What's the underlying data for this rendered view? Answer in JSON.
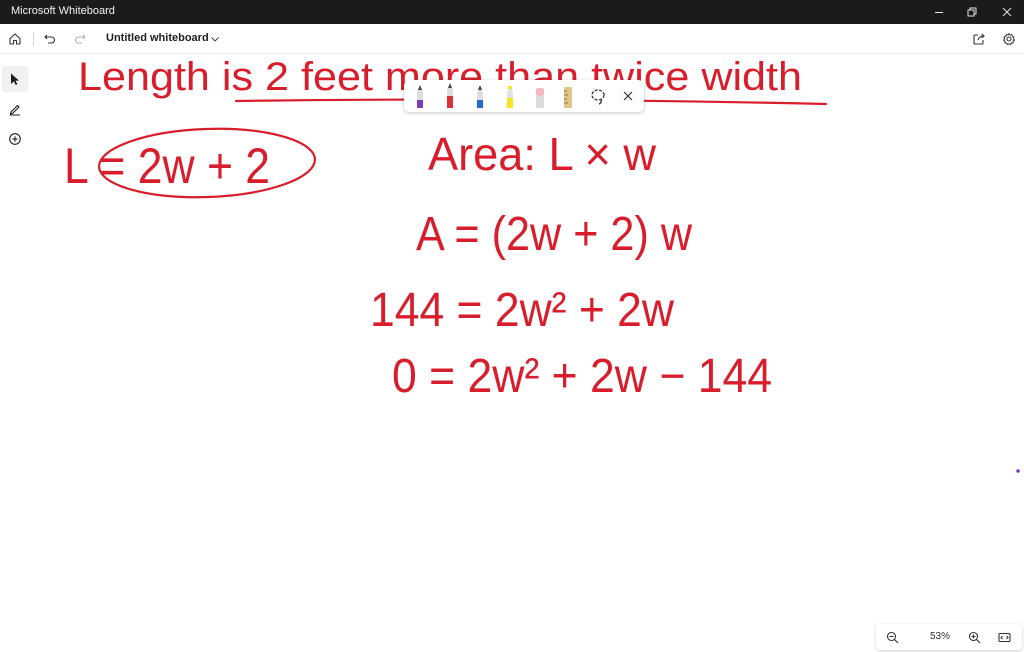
{
  "window": {
    "app_title": "Microsoft Whiteboard",
    "minimize_icon": "minimize-icon",
    "restore_icon": "restore-icon",
    "close_icon": "close-icon"
  },
  "toolbar": {
    "home_icon": "home-icon",
    "undo_icon": "undo-icon",
    "redo_icon": "redo-icon",
    "document_title": "Untitled whiteboard",
    "share_icon": "share-icon",
    "settings_icon": "gear-icon"
  },
  "left_tools": [
    {
      "name": "select-tool",
      "icon": "cursor-arrow-icon",
      "active": true
    },
    {
      "name": "inking-tool",
      "icon": "pen-icon",
      "active": false
    },
    {
      "name": "add-content",
      "icon": "plus-circle-icon",
      "active": false
    }
  ],
  "ink_toolbar": {
    "tools": [
      {
        "name": "purple-pen",
        "icon": "pen-icon",
        "color": "#7b3fb5"
      },
      {
        "name": "red-pen",
        "icon": "pen-icon",
        "color": "#d9323a",
        "selected": true
      },
      {
        "name": "blue-pen",
        "icon": "pen-icon",
        "color": "#1f6fd1"
      },
      {
        "name": "yellow-highlighter",
        "icon": "highlighter-icon",
        "color": "#f5e61e"
      },
      {
        "name": "eraser",
        "icon": "eraser-icon",
        "color": "#f3b7c6"
      },
      {
        "name": "ruler",
        "icon": "ruler-icon",
        "color": "#e2c48a"
      },
      {
        "name": "lasso",
        "icon": "lasso-icon"
      }
    ],
    "close_icon": "close-icon"
  },
  "whiteboard": {
    "ink_color": "#d81e2c",
    "line_heading": "Length is 2 feet more than twice width",
    "line_length_eq": "L = 2w + 2",
    "line_area_def": "Area: L × w",
    "line_area_sub": "A = (2w + 2) w",
    "line_eq_144": "144 = 2w² + 2w",
    "line_eq_zero": "0 = 2w² + 2w − 144"
  },
  "zoom": {
    "zoom_out_icon": "zoom-out-icon",
    "level": "53%",
    "zoom_in_icon": "zoom-in-icon",
    "fit_icon": "fit-to-screen-icon"
  }
}
